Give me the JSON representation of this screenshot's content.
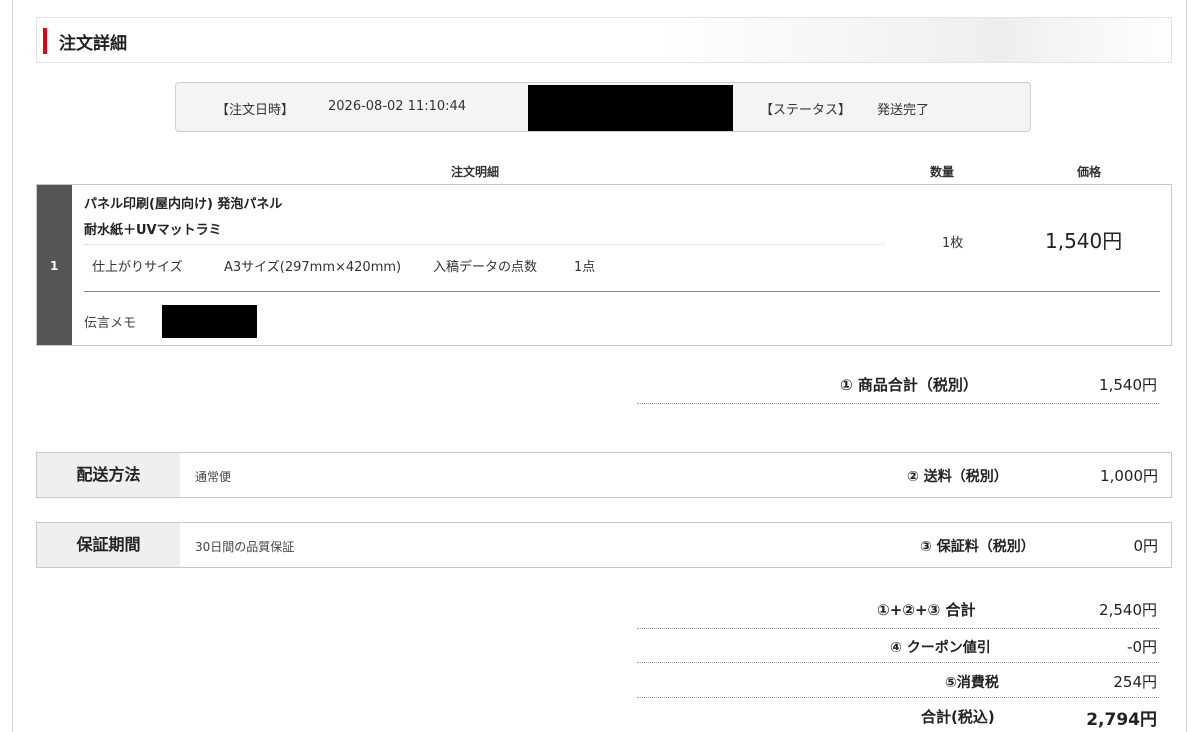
{
  "section": {
    "title": "注文詳細"
  },
  "order_info": {
    "date_label": "【注文日時】",
    "date_value": "2026-08-02 11:10:44",
    "status_label": "【ステータス】",
    "status_value": "発送完了"
  },
  "columns": {
    "detail": "注文明細",
    "quantity": "数量",
    "price": "価格"
  },
  "item": {
    "number": "1",
    "name_line1": "パネル印刷(屋内向け) 発泡パネル",
    "name_line2": "耐水紙＋UVマットラミ",
    "size_label": "仕上がりサイズ",
    "size_value": "A3サイズ(297mm×420mm)",
    "count_label": "入稿データの点数",
    "count_value": "1点",
    "memo_label": "伝言メモ",
    "quantity": "1枚",
    "price": "1,540円"
  },
  "subtotal": {
    "label": "① 商品合計（税別）",
    "value": "1,540円"
  },
  "shipping": {
    "label": "配送方法",
    "method": "通常便",
    "fee_label": "② 送料（税別）",
    "fee": "1,000円"
  },
  "warranty": {
    "label": "保証期間",
    "period": "30日間の品質保証",
    "fee_label": "③ 保証料（税別）",
    "fee": "0円"
  },
  "totals": [
    {
      "label": "①+②+③ 合計",
      "value": "2,540円"
    },
    {
      "label": "④ クーポン値引",
      "value": "-0円"
    },
    {
      "label": "⑤消費税",
      "value": "254円"
    },
    {
      "label": "合計(税込)",
      "value": "2,794円"
    }
  ],
  "colors": {
    "accent": "#e60012",
    "item_number_bg": "#555555",
    "label_bg": "#efefef"
  }
}
